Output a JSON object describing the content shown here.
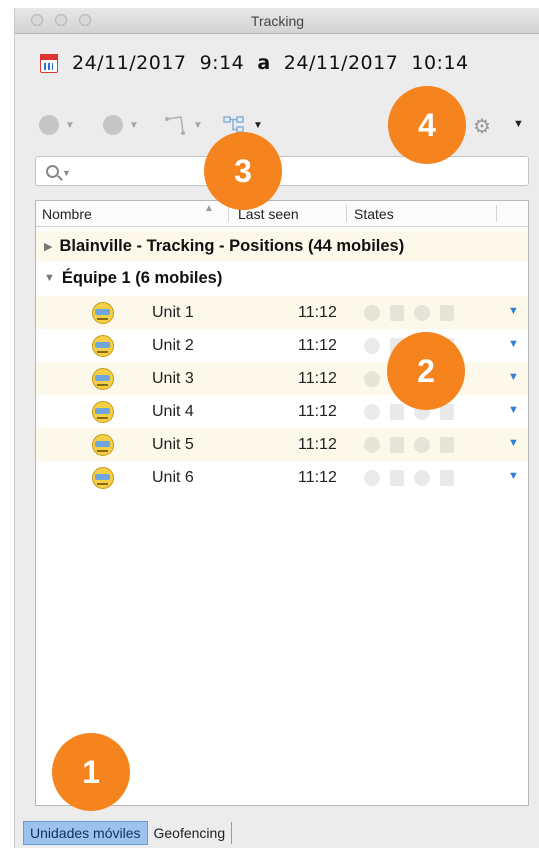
{
  "window": {
    "title": "Tracking"
  },
  "datebar": {
    "range_text": "24/11/2017  9:14  a  24/11/2017  10:14",
    "from": "24/11/2017  9:14",
    "separator": "a",
    "to": "24/11/2017  10:14"
  },
  "search": {
    "placeholder": "",
    "value": ""
  },
  "table": {
    "columns": [
      "Nombre",
      "Last seen",
      "States"
    ],
    "groups": [
      {
        "label": "Blainville - Tracking - Positions (44 mobiles)",
        "expanded": false
      },
      {
        "label": "Équipe 1 (6 mobiles)",
        "expanded": true
      }
    ],
    "rows": [
      {
        "name": "Unit 1",
        "last_seen": "11:12"
      },
      {
        "name": "Unit 2",
        "last_seen": "11:12"
      },
      {
        "name": "Unit 3",
        "last_seen": "11:12"
      },
      {
        "name": "Unit 4",
        "last_seen": "11:12"
      },
      {
        "name": "Unit 5",
        "last_seen": "11:12"
      },
      {
        "name": "Unit 6",
        "last_seen": "11:12"
      }
    ]
  },
  "tabs": [
    {
      "label": "Unidades móviles",
      "active": true
    },
    {
      "label": "Geofencing",
      "active": false
    }
  ],
  "callouts": [
    "1",
    "2",
    "3",
    "4"
  ],
  "icons": {
    "calendar": "calendar-icon",
    "settings": "gear-icon",
    "search": "search-icon",
    "unit": "bus-unit-icon",
    "row_menu": "chevron-down-icon"
  },
  "colors": {
    "callout": "#f5841e",
    "active_tab": "#9bc3ee",
    "alt_row": "#fcf8ea",
    "row_caret": "#2f7fd6"
  }
}
